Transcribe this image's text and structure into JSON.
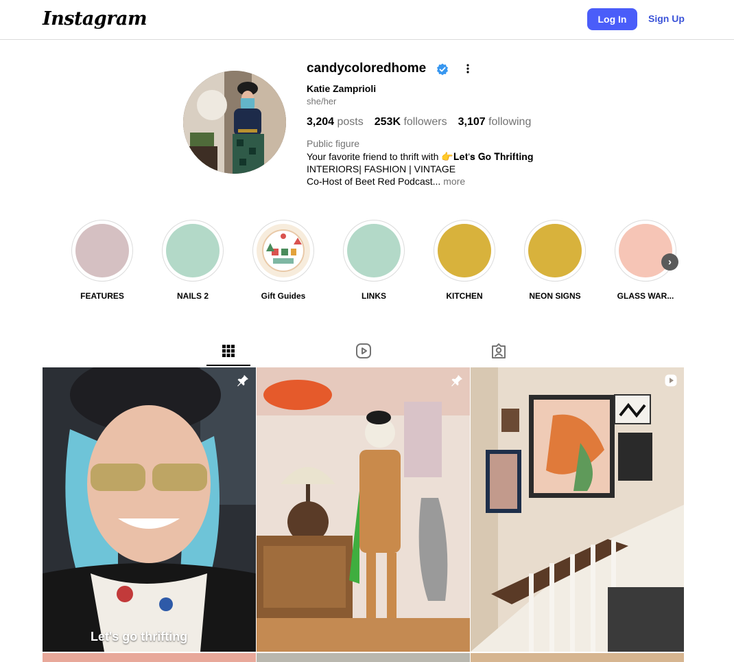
{
  "header": {
    "logo": "Instagram",
    "login_label": "Log In",
    "signup_label": "Sign Up"
  },
  "profile": {
    "username": "candycoloredhome",
    "verified": true,
    "full_name": "Katie Zamprioli",
    "pronouns": "she/her",
    "posts_count": "3,204",
    "posts_label": "posts",
    "followers_count": "253K",
    "followers_label": "followers",
    "following_count": "3,107",
    "following_label": "following",
    "category": "Public figure",
    "bio_line1": "Your favorite friend to thrift with 👉𝐋𝐞𝐭'𝐬 𝐆𝐨 𝐓𝐡𝐫𝐢𝐟𝐭𝐢𝐧𝐠",
    "bio_line2": "INTERIORS| FASHION | VINTAGE",
    "bio_line3": "Co-Host of Beet Red Podcast...",
    "bio_more": "more"
  },
  "highlights": [
    {
      "label": "FEATURES",
      "color": "#d5c0c2"
    },
    {
      "label": "NAILS 2",
      "color": "#b3d9c8"
    },
    {
      "label": "Gift Guides",
      "color": "#f4e4d4"
    },
    {
      "label": "LINKS",
      "color": "#b3d9c8"
    },
    {
      "label": "KITCHEN",
      "color": "#d8b23c"
    },
    {
      "label": "NEON SIGNS",
      "color": "#d8b23c"
    },
    {
      "label": "GLASS WAR...",
      "color": "#f6c5b6"
    }
  ],
  "tabs": [
    {
      "name": "posts",
      "icon": "grid-icon",
      "active": true
    },
    {
      "name": "reels",
      "icon": "reels-icon",
      "active": false
    },
    {
      "name": "tagged",
      "icon": "tagged-icon",
      "active": false
    }
  ],
  "posts": [
    {
      "badge": "pin-icon",
      "caption": "Let's go thrifting"
    },
    {
      "badge": "pin-icon"
    },
    {
      "badge": "reel-icon"
    }
  ],
  "colors": {
    "accent": "#4a5df9",
    "link": "#3a53d8",
    "verified": "#3897f0",
    "muted": "#737373"
  }
}
